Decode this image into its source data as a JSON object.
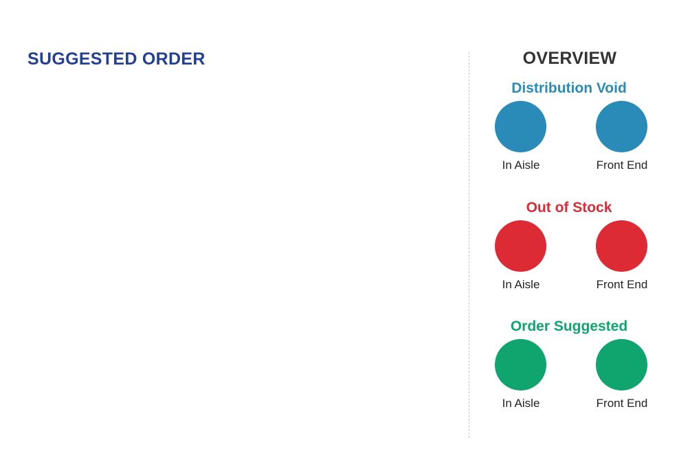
{
  "main": {
    "title": "SUGGESTED ORDER"
  },
  "overview": {
    "title": "OVERVIEW",
    "groups": [
      {
        "title": "Distribution Void",
        "color": "#2a8bb9",
        "left_label": "In Aisle",
        "right_label": "Front End"
      },
      {
        "title": "Out of Stock",
        "color": "#dd2b36",
        "left_label": "In Aisle",
        "right_label": "Front End"
      },
      {
        "title": "Order Suggested",
        "color": "#10a46e",
        "left_label": "In Aisle",
        "right_label": "Front End"
      }
    ]
  },
  "colors": {
    "main_title": "#233f93",
    "overview_title": "#333333",
    "divider": "#c4c4c4"
  }
}
